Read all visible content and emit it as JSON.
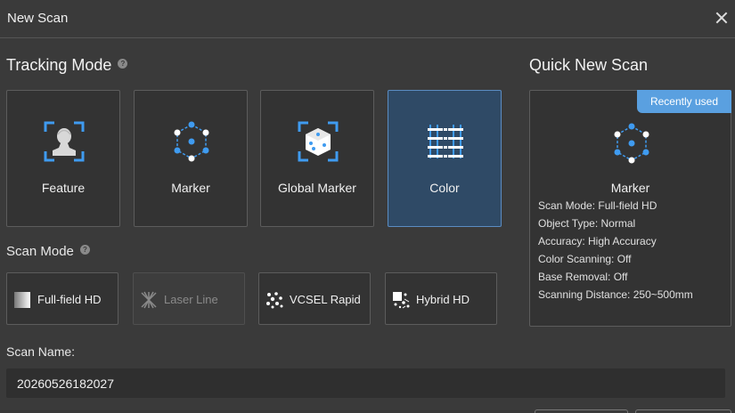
{
  "window": {
    "title": "New Scan"
  },
  "tracking": {
    "title": "Tracking Mode",
    "modes": [
      {
        "label": "Feature",
        "icon": "bust-icon",
        "selected": false
      },
      {
        "label": "Marker",
        "icon": "marker-hex-icon",
        "selected": false
      },
      {
        "label": "Global Marker",
        "icon": "global-marker-icon",
        "selected": false
      },
      {
        "label": "Color",
        "icon": "color-grid-icon",
        "selected": true
      }
    ]
  },
  "scan_mode": {
    "title": "Scan Mode",
    "options": [
      {
        "label": "Full-field HD",
        "icon": "full-field-icon",
        "enabled": true
      },
      {
        "label": "Laser Line",
        "icon": "laser-line-icon",
        "enabled": false
      },
      {
        "label": "VCSEL Rapid",
        "icon": "vcsel-icon",
        "enabled": true
      },
      {
        "label": "Hybrid HD",
        "icon": "hybrid-icon",
        "enabled": true
      }
    ]
  },
  "quick": {
    "title": "Quick New Scan",
    "badge": "Recently used",
    "name": "Marker",
    "details": [
      "Scan Mode:  Full-field HD",
      "Object Type:  Normal",
      "Accuracy:  High Accuracy",
      "Color Scanning:  Off",
      "Base Removal:  Off",
      "Scanning Distance:  250~500mm"
    ]
  },
  "scan_name": {
    "label": "Scan Name:",
    "value": "20260526182027"
  },
  "colors": {
    "accent": "#5aa0e0",
    "selected_bg": "#2f4a66"
  }
}
